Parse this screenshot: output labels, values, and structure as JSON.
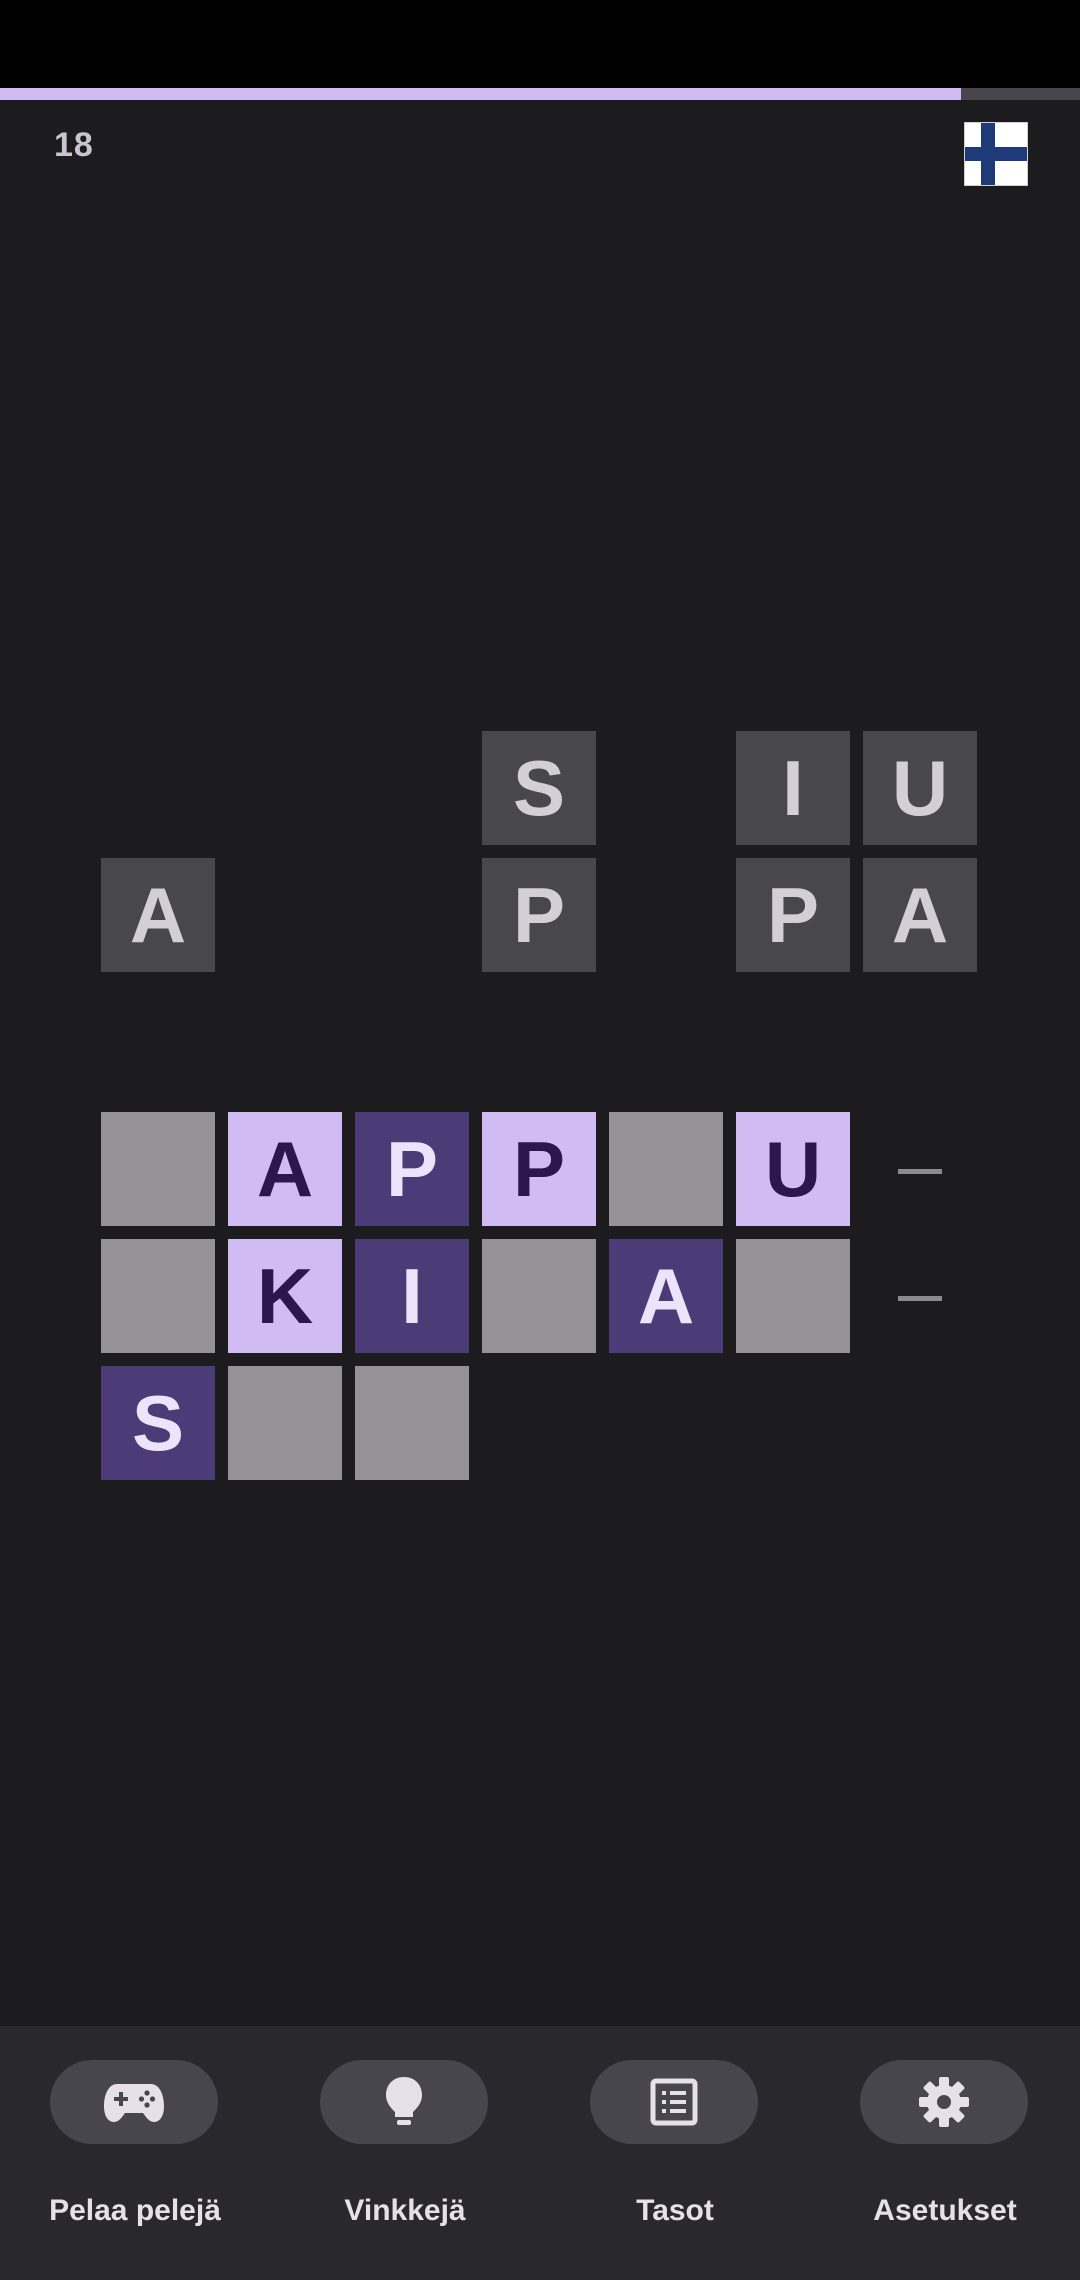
{
  "header": {
    "level_number": "18",
    "progress": 0.89,
    "language_flag": "finland-flag"
  },
  "pool_tiles": [
    "S",
    "I",
    "U",
    "A",
    "P",
    "P",
    "A"
  ],
  "answer_rows": [
    [
      "",
      "A",
      "P",
      "P",
      "",
      "U"
    ],
    [
      "",
      "K",
      "I",
      "",
      "A",
      ""
    ],
    [
      "S",
      "",
      ""
    ]
  ],
  "answer_tile_states": [
    [
      "empty",
      "light",
      "dark",
      "light",
      "empty",
      "light"
    ],
    [
      "empty",
      "light",
      "dark",
      "empty",
      "dark",
      "empty"
    ],
    [
      "dark",
      "empty",
      "empty"
    ]
  ],
  "bottom_nav": {
    "items": [
      {
        "label": "Pelaa pelejä",
        "icon": "gamepad-icon"
      },
      {
        "label": "Vinkkejä",
        "icon": "lightbulb-icon"
      },
      {
        "label": "Tasot",
        "icon": "list-icon"
      },
      {
        "label": "Asetukset",
        "icon": "gear-icon"
      }
    ]
  },
  "colors": {
    "background": "#1c1c1e",
    "accent_light": "#d0bcf2",
    "accent_dark": "#4d3b78",
    "empty_tile": "#949297",
    "pool_tile": "#48474b"
  }
}
